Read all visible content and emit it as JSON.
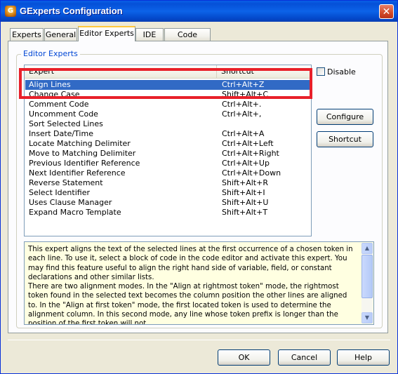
{
  "window": {
    "title": "GExperts Configuration",
    "close_glyph": "✕",
    "icon_glyph": "G"
  },
  "tabs": [
    {
      "label": "Experts"
    },
    {
      "label": "General"
    },
    {
      "label": "Editor Experts"
    },
    {
      "label": "IDE"
    },
    {
      "label": "Code Editor"
    }
  ],
  "active_tab": "Editor Experts",
  "group": {
    "title": "Editor Experts"
  },
  "list": {
    "columns": [
      "Expert",
      "Shortcut"
    ],
    "selected_index": 0,
    "rows": [
      {
        "name": "Align Lines",
        "shortcut": "Ctrl+Alt+Z"
      },
      {
        "name": "Change Case",
        "shortcut": "Shift+Alt+C"
      },
      {
        "name": "Comment Code",
        "shortcut": "Ctrl+Alt+."
      },
      {
        "name": "Uncomment Code",
        "shortcut": "Ctrl+Alt+,"
      },
      {
        "name": "Sort Selected Lines",
        "shortcut": ""
      },
      {
        "name": "Insert Date/Time",
        "shortcut": "Ctrl+Alt+A"
      },
      {
        "name": "Locate Matching Delimiter",
        "shortcut": "Ctrl+Alt+Left"
      },
      {
        "name": "Move to Matching Delimiter",
        "shortcut": "Ctrl+Alt+Right"
      },
      {
        "name": "Previous Identifier Reference",
        "shortcut": "Ctrl+Alt+Up"
      },
      {
        "name": "Next Identifier Reference",
        "shortcut": "Ctrl+Alt+Down"
      },
      {
        "name": "Reverse Statement",
        "shortcut": "Shift+Alt+R"
      },
      {
        "name": "Select Identifier",
        "shortcut": "Shift+Alt+I"
      },
      {
        "name": "Uses Clause Manager",
        "shortcut": "Shift+Alt+U"
      },
      {
        "name": "Expand Macro Template",
        "shortcut": "Shift+Alt+T"
      }
    ]
  },
  "disable_checkbox": {
    "label": "Disable",
    "checked": false
  },
  "buttons": {
    "configure": "Configure",
    "shortcut": "Shortcut",
    "ok": "OK",
    "cancel": "Cancel",
    "help": "Help"
  },
  "description": "   This expert aligns the text of the selected lines at the first occurrence of a chosen token in each line.  To use it, select a block of code in the code editor and activate this expert.  You may find this feature useful to align the right hand side of variable, field, or constant declarations and other similar lists.\n   There are two alignment modes.  In the \"Align at rightmost token\" mode, the rightmost token found in the selected text becomes the column position the other lines are aligned to.  In the \"Align at first token\" mode, the first located token is used to determine the alignment column.  In this second mode, any line whose token prefix is longer than the position of the first token will not",
  "scrollbar": {
    "up_glyph": "▲",
    "down_glyph": "▼"
  },
  "colors": {
    "titlebar": "#0550d8",
    "selection": "#316ac5",
    "annotation_box": "#e8202a",
    "description_bg": "#ffffe1"
  }
}
